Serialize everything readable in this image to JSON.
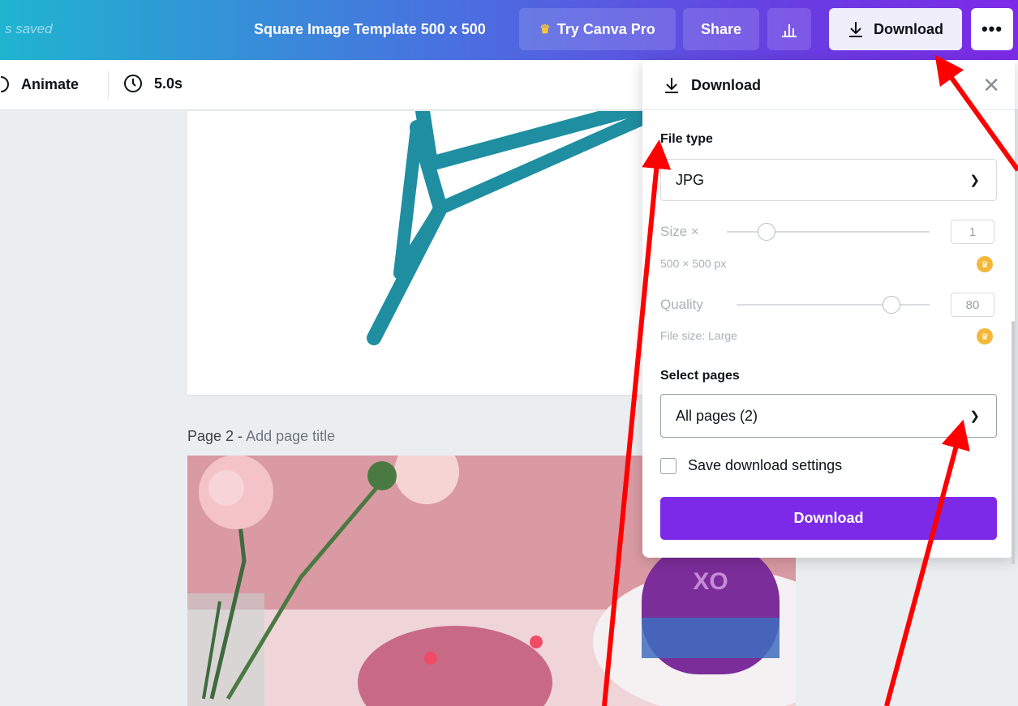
{
  "header": {
    "saved_text": "s saved",
    "doc_title": "Square Image Template 500 x 500",
    "try_pro_label": "Try Canva Pro",
    "share_label": "Share",
    "download_label": "Download",
    "more_label": "•••"
  },
  "toolbar": {
    "animate_label": "Animate",
    "duration_label": "5.0s"
  },
  "canvas": {
    "page2_label": "Page 2 -",
    "page2_sub": "Add page title",
    "xo_text": "XO"
  },
  "download_panel": {
    "title": "Download",
    "file_type_label": "File type",
    "file_type_value": "JPG",
    "size_label": "Size ×",
    "size_value": "1",
    "size_px": "500 × 500 px",
    "quality_label": "Quality",
    "quality_value": "80",
    "file_size": "File size: Large",
    "select_pages_label": "Select pages",
    "select_pages_value": "All pages (2)",
    "save_settings_label": "Save download settings",
    "download_button": "Download"
  },
  "colors": {
    "accent_purple": "#7d2ae8",
    "annotation_red": "#ff0000",
    "star_teal": "#1f8ea1"
  }
}
